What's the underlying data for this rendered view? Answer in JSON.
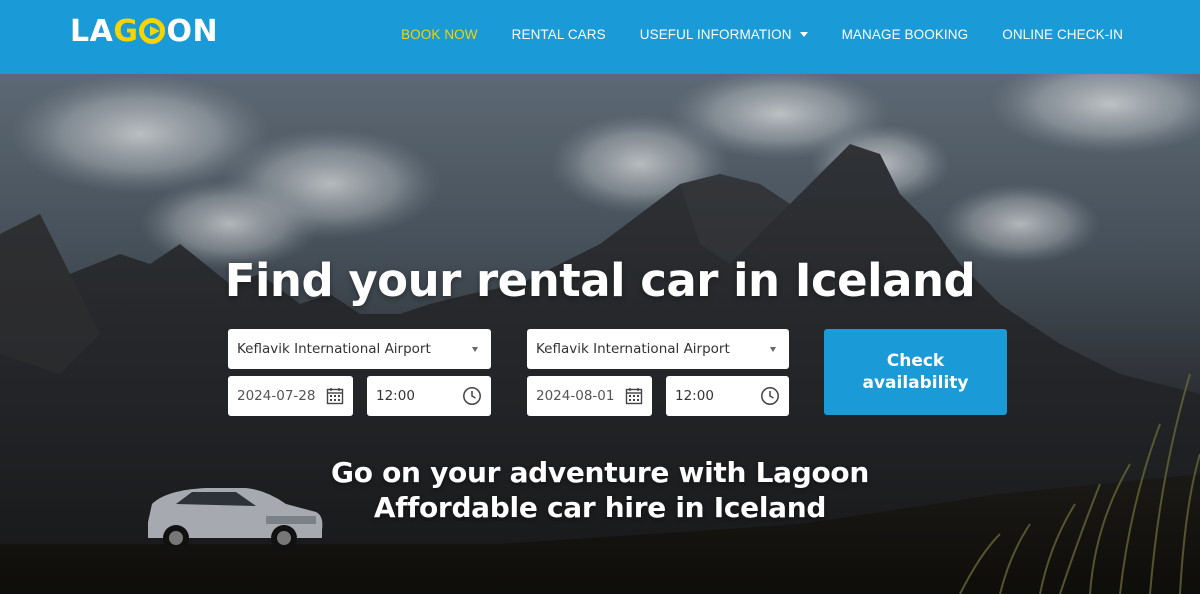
{
  "brand": {
    "logo_text_start": "LA",
    "logo_text_end": "N",
    "logo_text_full": "LAGOON",
    "primary_color": "#1a9ad6",
    "accent_color": "#f5d400"
  },
  "nav": {
    "items": [
      {
        "label": "BOOK NOW",
        "active": true
      },
      {
        "label": "RENTAL CARS",
        "active": false
      },
      {
        "label": "USEFUL INFORMATION",
        "active": false,
        "dropdown": true
      },
      {
        "label": "MANAGE BOOKING",
        "active": false
      },
      {
        "label": "ONLINE CHECK-IN",
        "active": false
      }
    ]
  },
  "hero": {
    "title": "Find your rental car in Iceland",
    "tagline_line1": "Go on your adventure with Lagoon",
    "tagline_line2": "Affordable car hire in Iceland"
  },
  "search": {
    "pickup": {
      "location": "Keflavik International Airport",
      "date": "2024-07-28",
      "time": "12:00"
    },
    "dropoff": {
      "location": "Keflavik International Airport",
      "date": "2024-08-01",
      "time": "12:00"
    },
    "submit_label": "Check availability"
  },
  "icons": {
    "calendar": "calendar-icon",
    "clock": "clock-icon",
    "dropdown": "chevron-down-icon"
  }
}
